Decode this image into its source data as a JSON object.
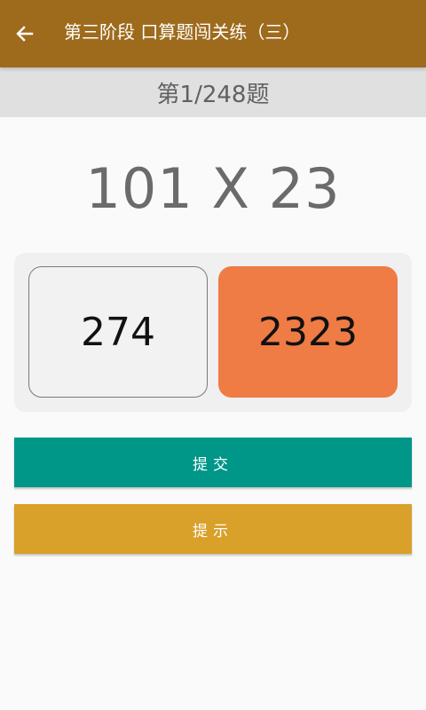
{
  "appbar": {
    "title": "第三阶段  口算题闯关练（三）",
    "back_icon": "arrow-left-icon"
  },
  "progress": {
    "text": "第1/248题"
  },
  "question": {
    "expression": "101 X 23"
  },
  "options": [
    {
      "label": "274"
    },
    {
      "label": "2323"
    }
  ],
  "buttons": {
    "submit_label": "提交",
    "hint_label": "提示"
  },
  "colors": {
    "appbar": "#9e6b1c",
    "progress_bg": "#e0e0e0",
    "option_selected": "#ef7b45",
    "submit": "#009688",
    "hint": "#d9a02a"
  }
}
